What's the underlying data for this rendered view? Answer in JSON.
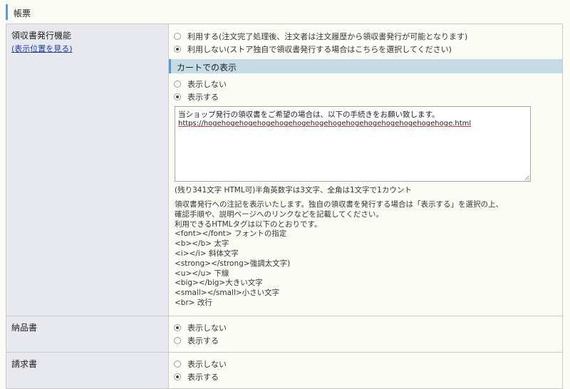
{
  "section": {
    "title": "帳票"
  },
  "receipt": {
    "label": "領収書発行機能",
    "link": "(表示位置を見る)",
    "options": [
      {
        "label": "利用する(注文完了処理後、注文者は注文履歴から領収書発行が可能となります)",
        "checked": false
      },
      {
        "label": "利用しない(ストア独自で領収書発行する場合はこちらを選択してください)",
        "checked": true
      }
    ],
    "cart": {
      "title": "カートでの表示",
      "options": [
        {
          "label": "表示しない",
          "checked": false
        },
        {
          "label": "表示する",
          "checked": true
        }
      ],
      "textarea_line1": "当ショップ発行の領収書をご希望の場合は、以下の手続きをお願い致します。",
      "textarea_line2": "https://hogehogehogehogehogehogehogehogehogehogehogehogehogehoge.html",
      "char_note": "(残り341文字 HTML可)半角英数字は3文字、全角は1文字で1カウント",
      "help_lines": [
        "領収書発行への注記を表示いたします。独自の領収書を発行する場合は「表示する」を選択の上、",
        "確認手順や、説明ページへのリンクなどを記載してください。",
        "利用できるHTMLタグは以下のとおりです。",
        "<font></font> フォントの指定",
        "<b></b> 太字",
        "<i></i> 斜体文字",
        "<strong></strong>強調太文字)",
        "<u></u> 下線",
        "<big></big>大きい文字",
        "<small></small>小さい文字",
        "<br> 改行"
      ]
    }
  },
  "delivery": {
    "label": "納品書",
    "options": [
      {
        "label": "表示しない",
        "checked": true
      },
      {
        "label": "表示する",
        "checked": false
      }
    ]
  },
  "invoice": {
    "label": "請求書",
    "options": [
      {
        "label": "表示しない",
        "checked": false
      },
      {
        "label": "表示する",
        "checked": true
      }
    ]
  },
  "colors": {
    "accent": "#5b9bd5",
    "subheader_bg": "#c5dbe6",
    "label_bg": "#e8e8ef",
    "link": "#1a3ea8"
  }
}
